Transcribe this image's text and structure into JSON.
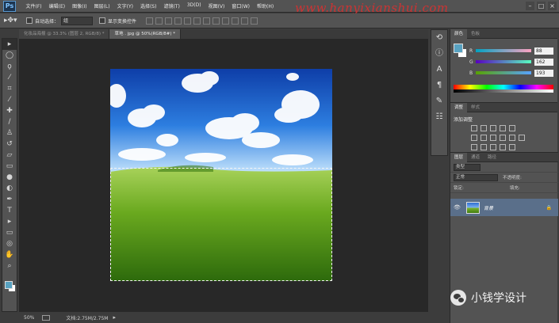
{
  "app": {
    "logo_text": "Ps"
  },
  "menu": [
    "文件(F)",
    "编辑(E)",
    "图像(I)",
    "图层(L)",
    "文字(Y)",
    "选择(S)",
    "滤镜(T)",
    "3D(D)",
    "视图(V)",
    "窗口(W)",
    "帮助(H)"
  ],
  "watermark_url": "www.hanyixianshui.com",
  "options": {
    "auto_select_label": "自动选择：",
    "auto_select_value": "组",
    "show_transform_label": "显示变换控件"
  },
  "tabs": [
    {
      "label": "化妆品海报 @ 33.3% (图层 2, RGB/8) *",
      "active": false
    },
    {
      "label": "草地 . jpg @ 50%(RGB/8#) *",
      "active": true
    }
  ],
  "status": {
    "zoom": "50%",
    "doc_info": "文档:2.75M/2.75M"
  },
  "color_panel": {
    "tabs": [
      "颜色",
      "色板"
    ],
    "r": "88",
    "g": "162",
    "b": "193",
    "fg_color": "#58a2c1"
  },
  "adjustments": {
    "tabs": [
      "调整",
      "样式"
    ],
    "title": "添加调整"
  },
  "layers_panel": {
    "tabs": [
      "图层",
      "通道",
      "路径"
    ],
    "kind_label": "类型",
    "blend_mode": "正常",
    "opacity_label": "不透明度:",
    "lock_label": "锁定:",
    "fill_label": "填充:",
    "layer_name": "背景"
  },
  "wechat_watermark": "小钱学设计"
}
